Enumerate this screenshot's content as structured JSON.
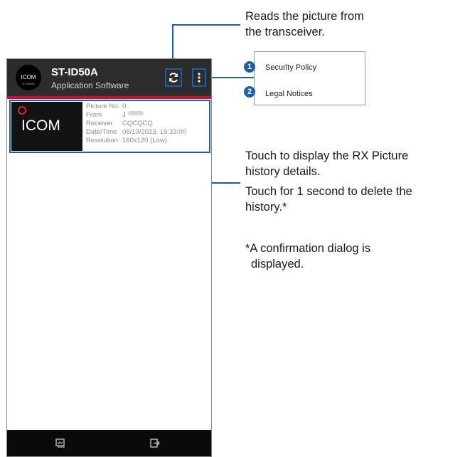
{
  "app": {
    "logo_text": "ICOM",
    "logo_sub": "ST-ID50A",
    "title": "ST-ID50A",
    "subtitle": "Application Software"
  },
  "icons": {
    "refresh": "refresh-icon",
    "menu": "more-vertical-icon",
    "bottom_left": "picture-icon",
    "bottom_right": "export-icon"
  },
  "history_item": {
    "thumbnail_text": "ICOM",
    "fields": [
      {
        "label": "Picture No.",
        "value": "0"
      },
      {
        "label": "From",
        "value": "J"
      },
      {
        "label": "Receiver",
        "value": "CQCQCQ"
      },
      {
        "label": "Date/Time",
        "value": "06/13/2023, 15:33:00"
      },
      {
        "label": "Resolution",
        "value": "160x120 (Low)"
      }
    ]
  },
  "menu": {
    "items": [
      {
        "number": "1",
        "label": "Security Policy"
      },
      {
        "number": "2",
        "label": "Legal Notices"
      }
    ]
  },
  "callouts": {
    "refresh_line1": "Reads the picture from",
    "refresh_line2": "the transceiver.",
    "history_line1": "Touch to display the RX Picture",
    "history_line2": "history details.",
    "history_line3": "Touch for 1 second to delete the",
    "history_line4": "history.*",
    "note_line1": "*A confirmation dialog is",
    "note_line2": "displayed."
  },
  "colors": {
    "accent": "#1c5fa8",
    "appbar": "#2c2c2c",
    "brand_red": "#c8102e"
  }
}
